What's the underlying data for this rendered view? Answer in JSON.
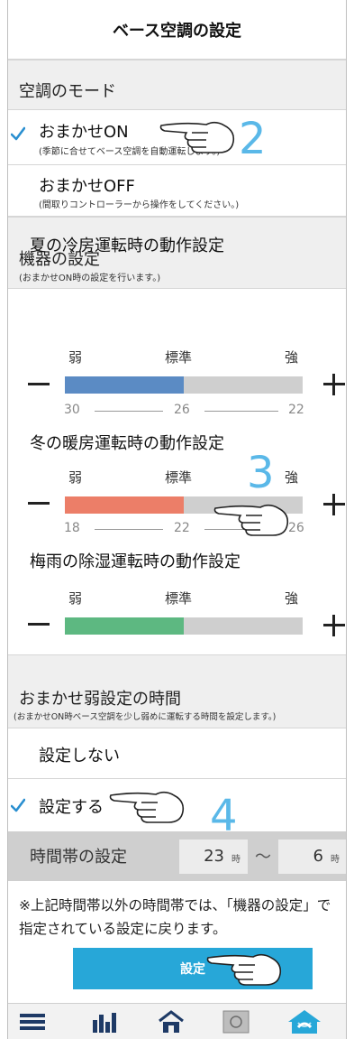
{
  "header": {
    "title": "ベース空調の設定"
  },
  "mode_section": {
    "title": "空調のモード",
    "options": [
      {
        "label": "おまかせON",
        "sub": "(季節に合せてベース空調を自動運転します。)",
        "checked": true
      },
      {
        "label": "おまかせOFF",
        "sub": "(間取りコントローラーから操作をしてください。)",
        "checked": false
      }
    ]
  },
  "device_section": {
    "title": "機器の設定",
    "sub": "(おまかせON時の設定を行います。)",
    "level_labels": {
      "low": "弱",
      "mid": "標準",
      "high": "強"
    },
    "controls": [
      {
        "title": "夏の冷房運転時の動作設定",
        "fill_color": "#5b8bc4",
        "fill_fraction": 0.5,
        "scale": [
          "30",
          "26",
          "22"
        ]
      },
      {
        "title": "冬の暖房運転時の動作設定",
        "fill_color": "#ec7e68",
        "fill_fraction": 0.5,
        "scale": [
          "18",
          "22",
          "26"
        ]
      },
      {
        "title": "梅雨の除湿運転時の動作設定",
        "fill_color": "#5db881",
        "fill_fraction": 0.5,
        "scale": []
      }
    ]
  },
  "weak_section": {
    "title": "おまかせ弱設定の時間",
    "sub": "(おまかせON時ベース空調を少し弱めに運転する時間を設定します。)",
    "options": [
      {
        "label": "設定しない",
        "checked": false
      },
      {
        "label": "設定する",
        "checked": true
      }
    ]
  },
  "time_row": {
    "label": "時間帯の設定",
    "start_value": "23",
    "start_unit": "時",
    "separator": "〜",
    "end_value": "6",
    "end_unit": "時"
  },
  "note": "※上記時間帯以外の時間帯では、「機器の設定」で指定されている設定に戻ります。",
  "set_button": {
    "label": "設定"
  },
  "step_numbers": [
    "2",
    "3",
    "4"
  ],
  "tabbar": {
    "icons": [
      "list-icon",
      "bar-chart-icon",
      "house-icon",
      "floor-panel-icon",
      "base-aircon-icon"
    ],
    "active_index": 4
  },
  "colors": {
    "accent": "#27a7d8",
    "check": "#2a8fd0",
    "step_number": "#5ab8e8",
    "cooling": "#5b8bc4",
    "heating": "#ec7e68",
    "dehumidify": "#5db881",
    "bar_track": "#cfcfcf"
  }
}
